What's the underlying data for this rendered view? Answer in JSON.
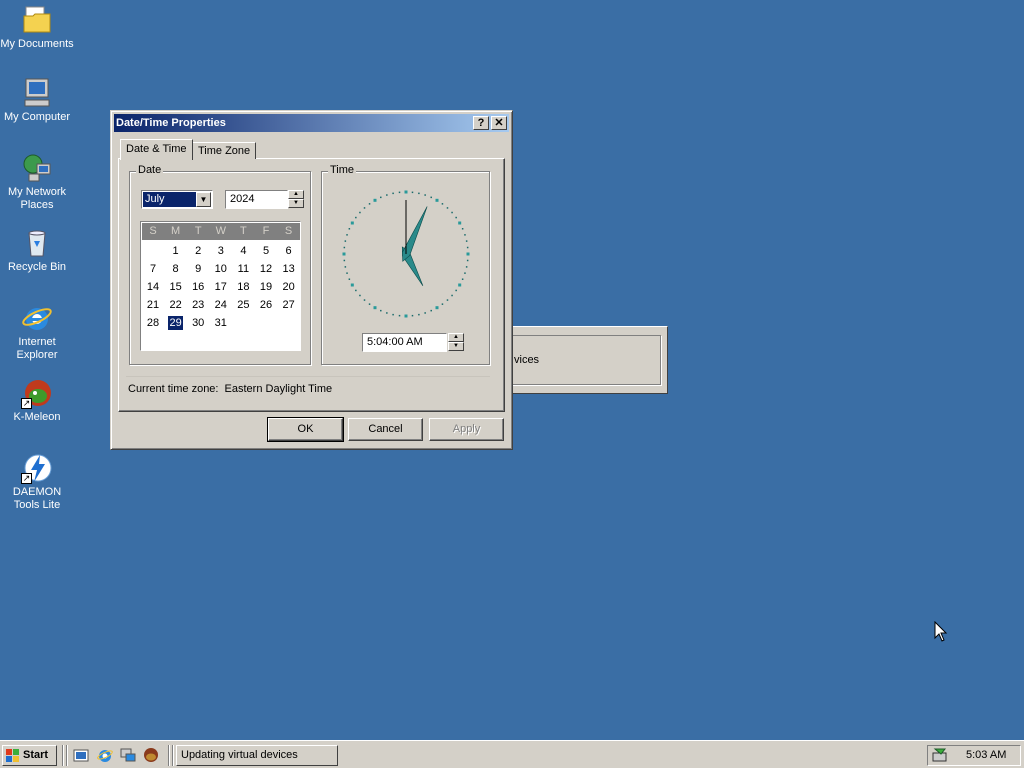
{
  "desktop": {
    "icons": [
      {
        "label": "My Documents",
        "icon": "folder-documents-icon"
      },
      {
        "label": "My Computer",
        "icon": "computer-icon"
      },
      {
        "label": "My Network Places",
        "icon": "network-icon"
      },
      {
        "label": "Recycle Bin",
        "icon": "recycle-bin-icon"
      },
      {
        "label": "Internet Explorer",
        "icon": "internet-explorer-icon"
      },
      {
        "label": "K-Meleon",
        "icon": "k-meleon-icon"
      },
      {
        "label": "DAEMON Tools Lite",
        "icon": "daemon-tools-icon"
      }
    ]
  },
  "background_window": {
    "text": "vices"
  },
  "dialog": {
    "title": "Date/Time Properties",
    "help_label": "?",
    "close_label": "✕",
    "tabs": [
      {
        "label": "Date & Time",
        "active": true
      },
      {
        "label": "Time Zone",
        "active": false
      }
    ],
    "date_group": {
      "label": "Date",
      "month": "July",
      "year": "2024",
      "weekdays": [
        "S",
        "M",
        "T",
        "W",
        "T",
        "F",
        "S"
      ],
      "weeks": [
        [
          "",
          "1",
          "2",
          "3",
          "4",
          "5",
          "6"
        ],
        [
          "7",
          "8",
          "9",
          "10",
          "11",
          "12",
          "13"
        ],
        [
          "14",
          "15",
          "16",
          "17",
          "18",
          "19",
          "20"
        ],
        [
          "21",
          "22",
          "23",
          "24",
          "25",
          "26",
          "27"
        ],
        [
          "28",
          "29",
          "30",
          "31",
          "",
          "",
          ""
        ]
      ],
      "selected_day": "29"
    },
    "time_group": {
      "label": "Time",
      "time_value": "5:04:00 AM",
      "clock": {
        "hour": 5,
        "minute": 4,
        "second": 0
      }
    },
    "timezone_label": "Current time zone:",
    "timezone_value": "Eastern Daylight Time",
    "buttons": {
      "ok": "OK",
      "cancel": "Cancel",
      "apply": "Apply"
    }
  },
  "taskbar": {
    "start_label": "Start",
    "quicklaunch": [
      "show-desktop-icon",
      "internet-explorer-icon",
      "network-icon",
      "k-meleon-icon"
    ],
    "task_label": "Updating virtual devices",
    "clock": "5:03 AM"
  },
  "colors": {
    "desktop": "#3a6ea5",
    "titlebar_start": "#0a246a",
    "titlebar_end": "#a6caf0",
    "face": "#d4d0c8"
  }
}
